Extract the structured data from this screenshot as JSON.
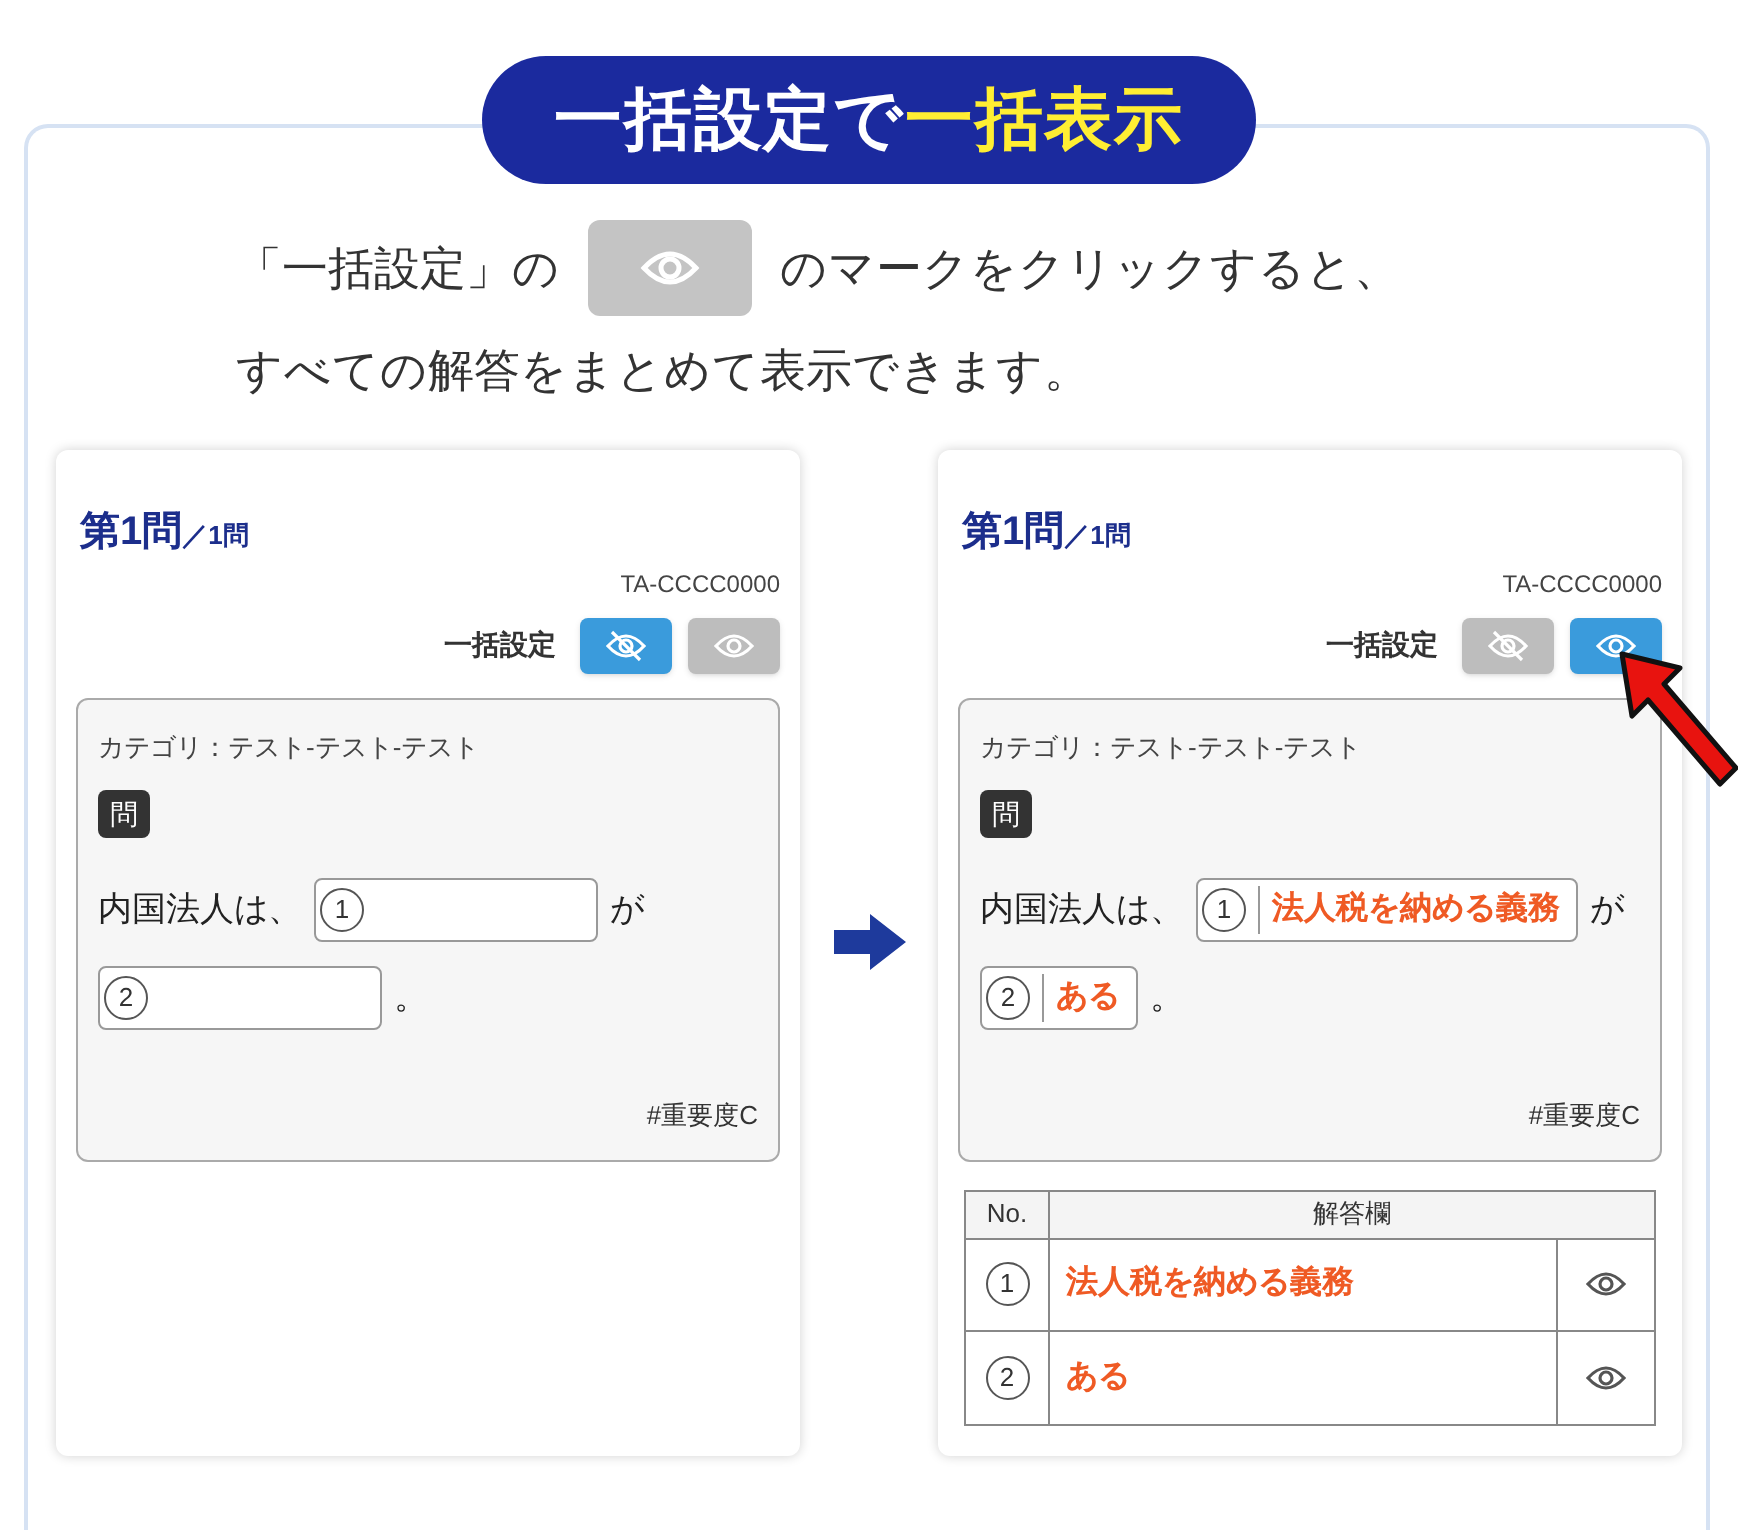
{
  "title_parts": [
    {
      "text": "一括設定で",
      "highlight": false
    },
    {
      "text": "一括表示",
      "highlight": true
    }
  ],
  "instruction": {
    "before": "「一括設定」の",
    "after": "のマークをクリックすると、",
    "line2": "すべての解答をまとめて表示できます。"
  },
  "panels": [
    {
      "question_no": "第1問",
      "total": "／1問",
      "code": "TA-CCCC0000",
      "bulk_label": "一括設定",
      "toggles": [
        {
          "kind": "hide",
          "selected": true
        },
        {
          "kind": "show",
          "selected": false
        }
      ],
      "category": "カテゴリ：テスト-テスト-テスト",
      "badge": "問",
      "sentence": [
        {
          "kind": "text",
          "text": "内国法人は、"
        },
        {
          "kind": "blank",
          "number": "1"
        },
        {
          "kind": "text",
          "text": "が"
        },
        {
          "kind": "break"
        },
        {
          "kind": "blank",
          "number": "2"
        },
        {
          "kind": "text",
          "text": "。"
        }
      ],
      "tag": "#重要度C"
    },
    {
      "question_no": "第1問",
      "total": "／1問",
      "code": "TA-CCCC0000",
      "bulk_label": "一括設定",
      "toggles": [
        {
          "kind": "hide",
          "selected": false
        },
        {
          "kind": "show",
          "selected": true
        }
      ],
      "category": "カテゴリ：テスト-テスト-テスト",
      "badge": "問",
      "sentence": [
        {
          "kind": "text",
          "text": "内国法人は、"
        },
        {
          "kind": "blank",
          "number": "1",
          "answer": "法人税を納める義務"
        },
        {
          "kind": "text",
          "text": "が"
        },
        {
          "kind": "break"
        },
        {
          "kind": "blank",
          "number": "2",
          "answer": "ある"
        },
        {
          "kind": "text",
          "text": "。"
        }
      ],
      "tag": "#重要度C",
      "answer_table": {
        "columns": [
          "No.",
          "解答欄"
        ],
        "rows": [
          {
            "number": "1",
            "answer": "法人税を納める義務"
          },
          {
            "number": "2",
            "answer": "ある"
          }
        ]
      }
    }
  ]
}
